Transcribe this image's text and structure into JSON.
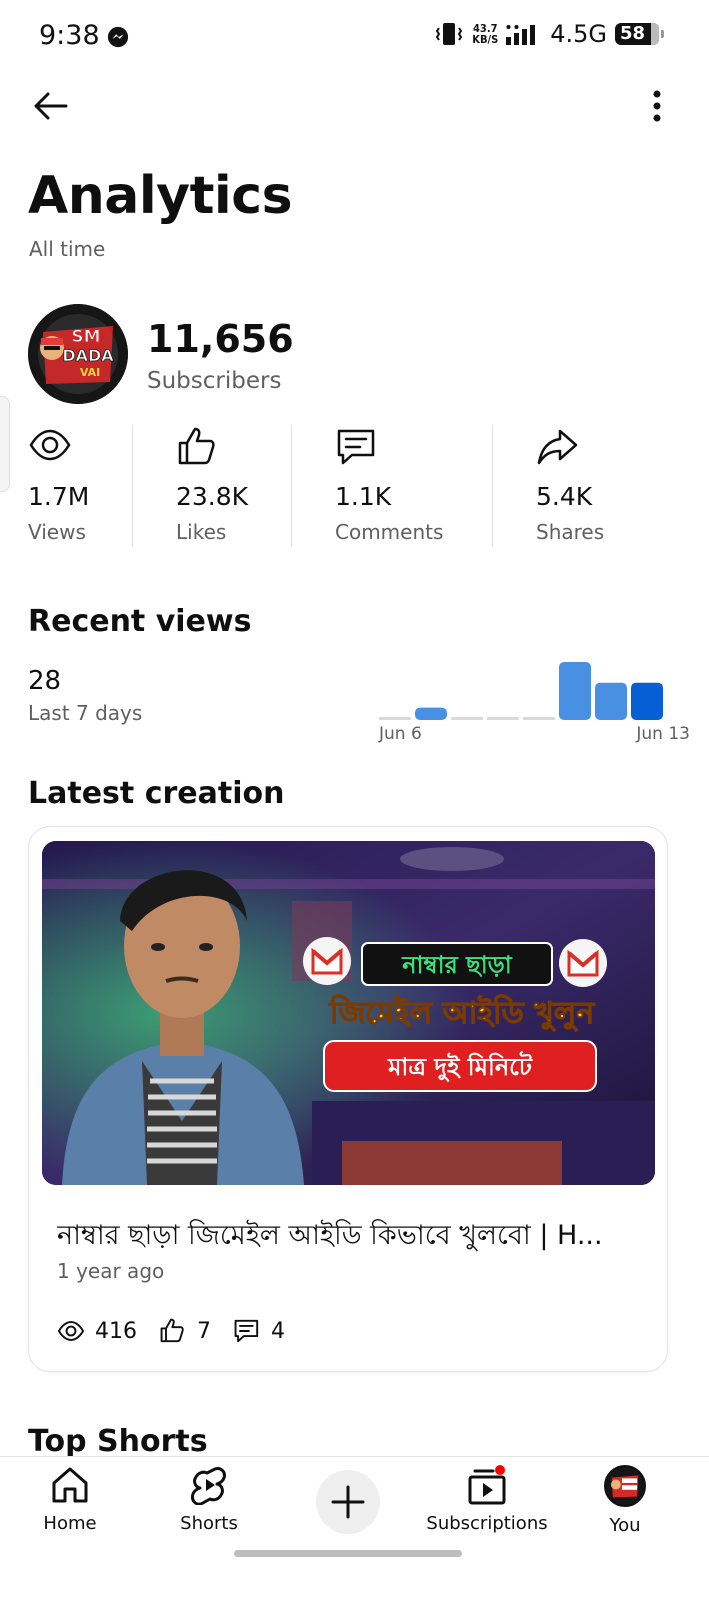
{
  "status_bar": {
    "time": "9:38",
    "speed_value": "43.7",
    "speed_unit": "KB/S",
    "network": "4.5G",
    "battery": "58"
  },
  "header": {
    "title": "Analytics",
    "subtitle": "All time"
  },
  "channel": {
    "avatar_text_1": "SM",
    "avatar_text_2": "DADA",
    "avatar_text_3": "VAI",
    "subscriber_count": "11,656",
    "subscriber_label": "Subscribers"
  },
  "stats": [
    {
      "icon": "eye-icon",
      "value": "1.7M",
      "label": "Views"
    },
    {
      "icon": "thumbs-up-icon",
      "value": "23.8K",
      "label": "Likes"
    },
    {
      "icon": "comment-icon",
      "value": "1.1K",
      "label": "Comments"
    },
    {
      "icon": "share-icon",
      "value": "5.4K",
      "label": "Shares"
    }
  ],
  "recent_views": {
    "title": "Recent views",
    "count": "28",
    "period": "Last 7 days",
    "start_label": "Jun 6",
    "end_label": "Jun 13"
  },
  "chart_data": {
    "type": "bar",
    "title": "",
    "categories": [
      "Jun 6",
      "",
      "",
      "",
      "",
      "",
      "",
      "Jun 13"
    ],
    "values": [
      0,
      3,
      0,
      0,
      0,
      14,
      9,
      9
    ],
    "ylim": [
      0,
      14
    ],
    "grid": false,
    "colors": {
      "bar": "#4a90e2",
      "last_bar": "#065fd4",
      "zero_bar": "#d9d9d9"
    }
  },
  "latest_creation": {
    "title": "Latest creation",
    "thumbnail_text_1": "নাম্বার ছাড়া",
    "thumbnail_text_2": "জিমেইল আইডি খুলুন",
    "thumbnail_text_3": "মাত্র দুই মিনিটে",
    "video_title": "নাম্বার ছাড়া জিমেইল আইডি কিভাবে খুলবো | H...",
    "age": "1 year ago",
    "views": "416",
    "likes": "7",
    "comments": "4"
  },
  "top_shorts": {
    "title": "Top Shorts"
  },
  "bottom_nav": {
    "home": "Home",
    "shorts": "Shorts",
    "subscriptions": "Subscriptions",
    "you": "You"
  },
  "colors": {
    "accent_blue": "#065fd4",
    "notification_red": "#ff0000",
    "text_secondary": "#606060"
  }
}
